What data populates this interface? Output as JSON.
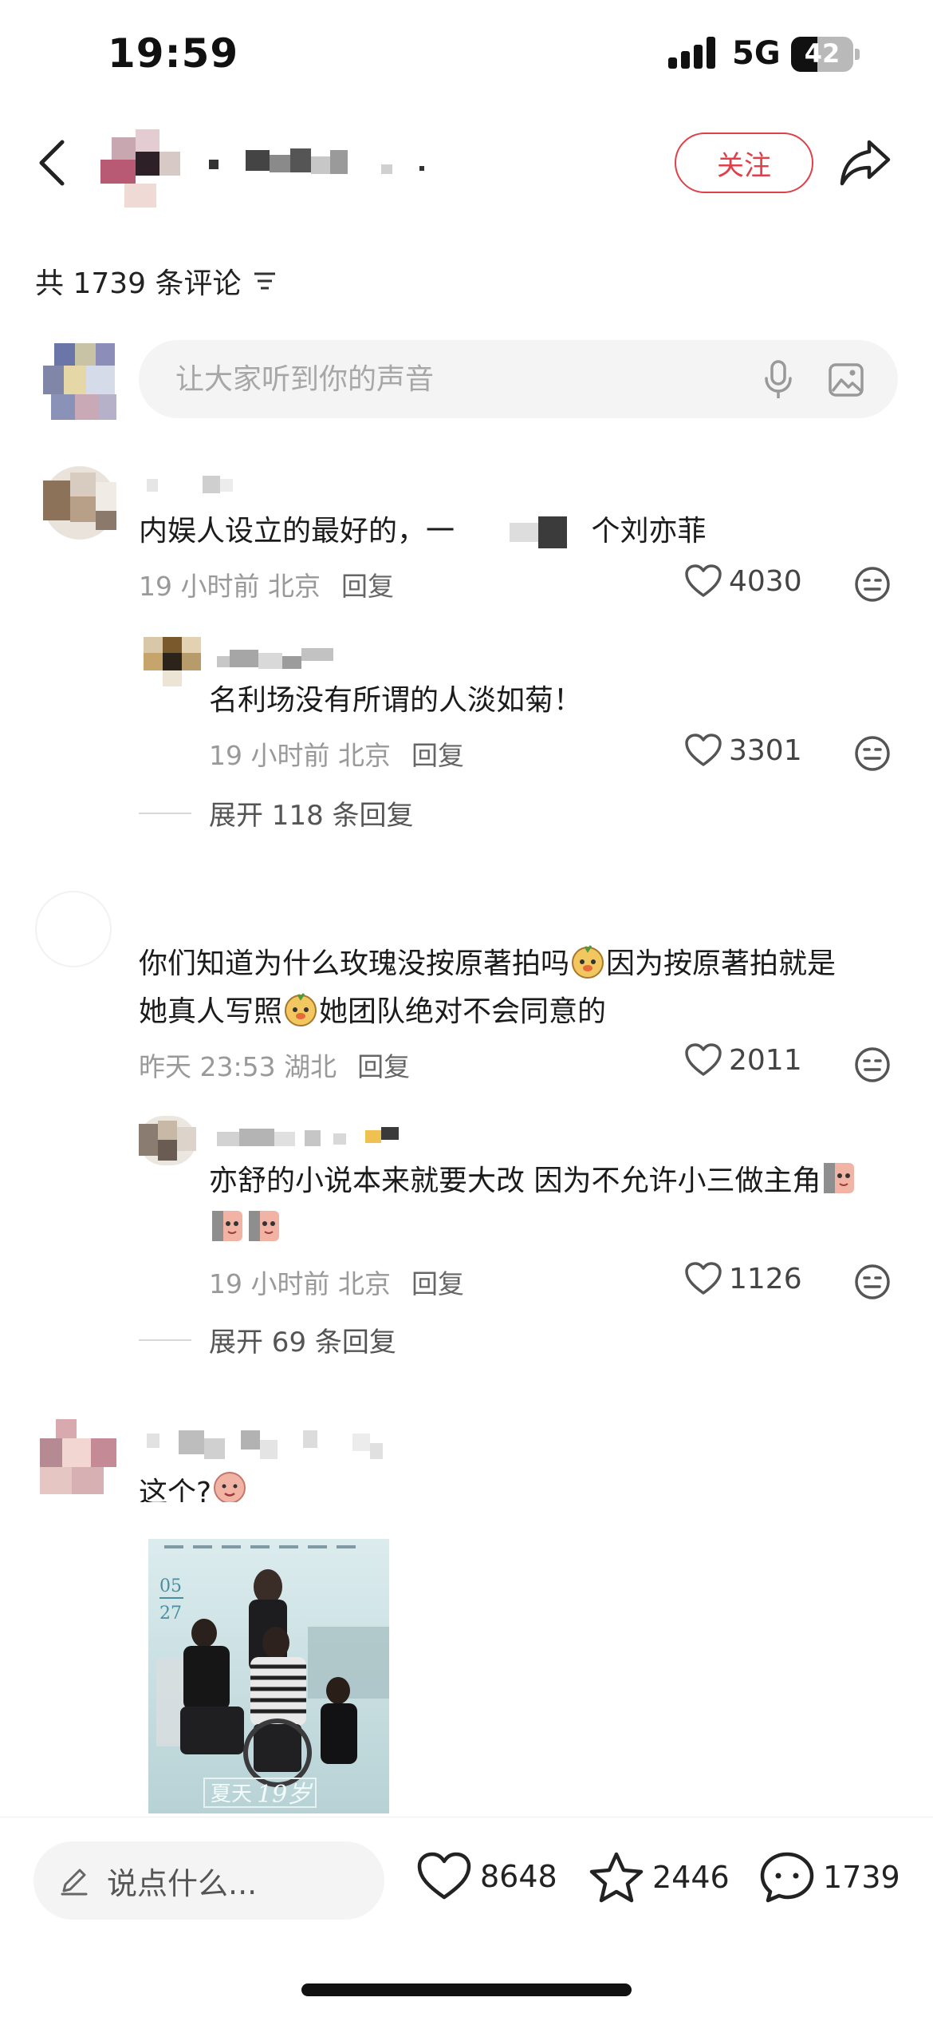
{
  "status_bar": {
    "time": "19:59",
    "network": "5G",
    "battery": "42",
    "battery_level": 0.42
  },
  "header": {
    "follow_label": "关注"
  },
  "comments_header": {
    "count_label": "共 1739 条评论"
  },
  "comment_input": {
    "placeholder": "让大家听到你的声音"
  },
  "comments": [
    {
      "text": "内娱人设立的最好的，一",
      "text_tail": "个刘亦菲",
      "meta": "19 小时前 北京",
      "reply_label": "回复",
      "likes": "4030",
      "replies": [
        {
          "text": "名利场没有所谓的人淡如菊！",
          "meta": "19 小时前 北京",
          "reply_label": "回复",
          "likes": "3301"
        }
      ],
      "expand_label": "展开 118 条回复"
    },
    {
      "text_part1": "你们知道为什么玫瑰没按原著拍吗",
      "text_part2": "因为按原著拍就是",
      "text_part3": "她真人写照",
      "text_part4": "她团队绝对不会同意的",
      "meta": "昨天 23:53 湖北",
      "reply_label": "回复",
      "likes": "2011",
      "replies": [
        {
          "text": "亦舒的小说本来就要大改 因为不允许小三做主角",
          "meta": "19 小时前 北京",
          "reply_label": "回复",
          "likes": "1126"
        }
      ],
      "expand_label": "展开 69 条回复"
    },
    {
      "text": "这个?",
      "poster": {
        "date_month": "05",
        "date_day": "27",
        "title_part1": "夏天",
        "title_part2": "19岁"
      }
    }
  ],
  "bottom_bar": {
    "say_placeholder": "说点什么...",
    "likes": "8648",
    "favorites": "2446",
    "comments": "1739"
  },
  "colors": {
    "accent": "#e0404a",
    "meta_gray": "#999999",
    "input_bg": "#f4f4f4"
  }
}
